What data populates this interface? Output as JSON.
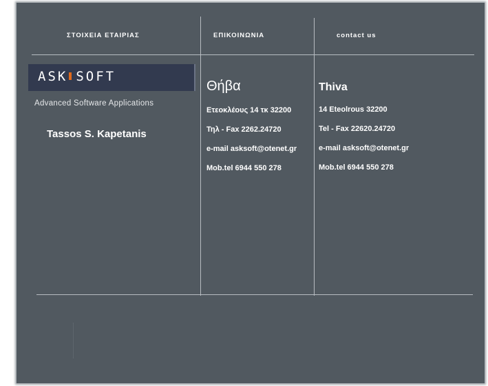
{
  "headers": {
    "company": "ΣΤΟΙΧΕΙΑ ΕΤΑΙΡΙΑΣ",
    "contact_gr": "ΕΠΙΚΟΙΝΩΝΙΑ",
    "contact_en": "contact us"
  },
  "logo": {
    "left": "ASK",
    "right": "SOFT",
    "accent_color": "#e06a1c"
  },
  "company": {
    "tagline": "Advanced Software Applications",
    "person": "Tassos S. Kapetanis"
  },
  "contact_gr": {
    "city": "Θήβα",
    "address": "Ετεοκλέους 14  τκ 32200",
    "phone_fax": "Τηλ - Fax  2262.24720",
    "email": "e-mail  asksoft@otenet.gr",
    "mobile": "Mob.tel 6944 550 278"
  },
  "contact_en": {
    "city": "Thiva",
    "address": "14 Eteolrous  32200",
    "phone_fax": "Tel - Fax   22620.24720",
    "email": "e-mail  asksoft@otenet.gr",
    "mobile": "Mob.tel 6944 550 278"
  },
  "colors": {
    "panel": "#515960",
    "lines": "#b8bdc2",
    "logo_bg": "#323a4f"
  }
}
